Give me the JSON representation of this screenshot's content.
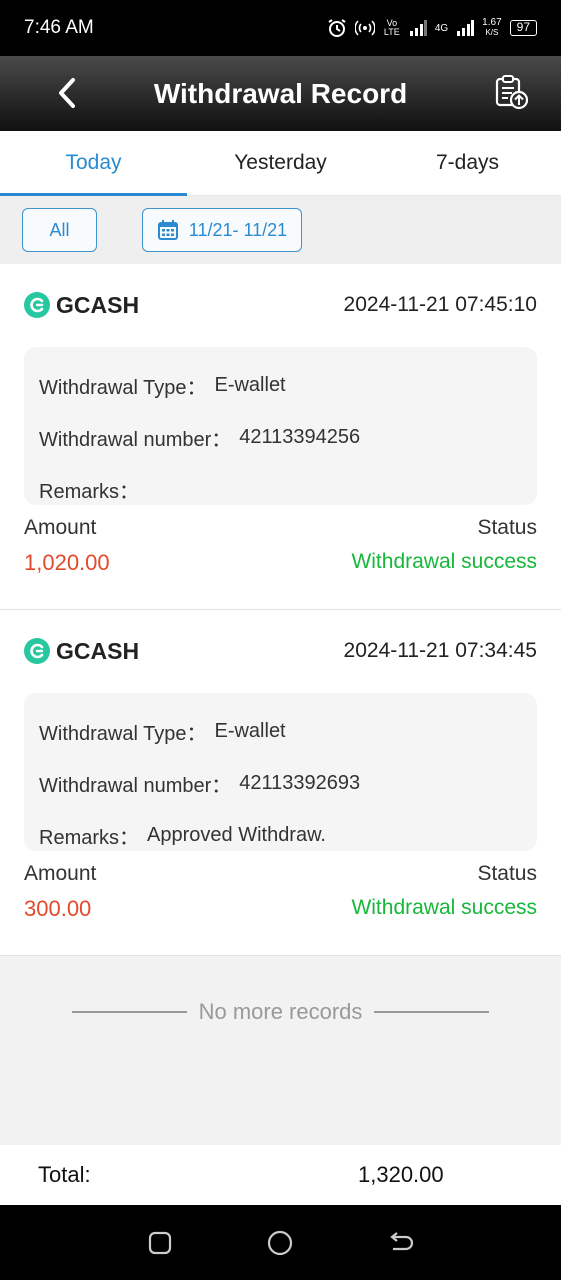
{
  "status_bar": {
    "time": "7:46 AM",
    "network_label": "4G",
    "volte_label": "Vo LTE",
    "speed_value": "1.67",
    "speed_unit": "K/S",
    "battery": "97"
  },
  "header": {
    "title": "Withdrawal Record"
  },
  "tabs": [
    {
      "label": "Today",
      "active": true
    },
    {
      "label": "Yesterday",
      "active": false
    },
    {
      "label": "7-days",
      "active": false
    }
  ],
  "filters": {
    "all_label": "All",
    "date_range": "11/21- 11/21"
  },
  "records": [
    {
      "brand": "GCASH",
      "datetime": "2024-11-21 07:45:10",
      "type_label": "Withdrawal Type：",
      "type_value": "E-wallet",
      "number_label": "Withdrawal number：",
      "number_value": "42113394256",
      "remarks_label": "Remarks：",
      "remarks_value": "",
      "amount_label": "Amount",
      "status_label": "Status",
      "amount": "1,020.00",
      "status": "Withdrawal success"
    },
    {
      "brand": "GCASH",
      "datetime": "2024-11-21 07:34:45",
      "type_label": "Withdrawal Type：",
      "type_value": "E-wallet",
      "number_label": "Withdrawal number：",
      "number_value": "42113392693",
      "remarks_label": "Remarks：",
      "remarks_value": "Approved Withdraw.",
      "amount_label": "Amount",
      "status_label": "Status",
      "amount": "300.00",
      "status": "Withdrawal success"
    }
  ],
  "no_more_text": "No more records",
  "total": {
    "label": "Total:",
    "value": "1,320.00"
  },
  "colors": {
    "accent": "#2a8bd1",
    "amount": "#e34a2a",
    "success": "#17b83a",
    "gcash": "#27c7a0"
  }
}
